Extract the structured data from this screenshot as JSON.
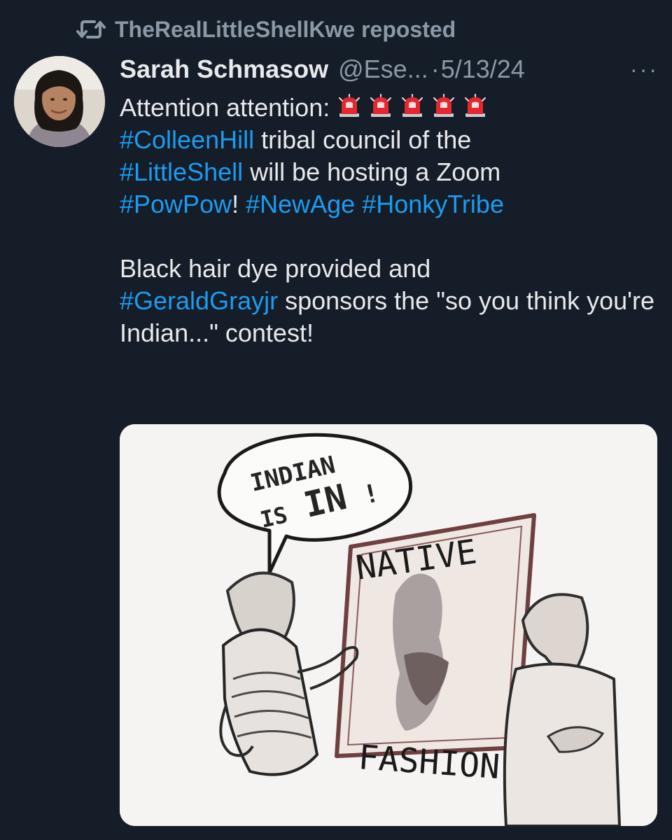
{
  "repost": {
    "icon": "repost-icon",
    "text": "TheRealLittleShellKwe reposted"
  },
  "author": {
    "avatar": "avatar",
    "name": "Sarah Schmasow",
    "handle": "@Ese...",
    "separator": "·",
    "date": "5/13/24",
    "more_icon": "more-icon",
    "more_text": "···"
  },
  "tweet": {
    "line1_text": "Attention attention:",
    "siren_icon": "siren-icon",
    "siren_count": 5,
    "tag_colleenhill": "#ColleenHill",
    "text_tribal_council": " tribal council of the",
    "tag_littleshell": "#LittleShell",
    "text_hosting": " will be hosting a Zoom",
    "tag_powpow": "#PowPow",
    "text_bang": "! ",
    "tag_newage": "#NewAge",
    "text_space": " ",
    "tag_honkytribe": "#HonkyTribe",
    "text_hair": "Black hair dye provided and",
    "tag_geraldgray": "#GeraldGrayjr",
    "text_sponsors": " sponsors the \"so you think you're Indian...\" contest!"
  },
  "media": {
    "speech_line1": "INDIAN",
    "speech_line2_prefix": "IS",
    "speech_line2_emphasis": "IN",
    "speech_line2_suffix": "!",
    "poster_top": "NATIVE",
    "poster_bottom": "FASHION"
  },
  "colors": {
    "background": "#151d28",
    "primary_text": "#e7e9ea",
    "secondary_text": "#8b98a5",
    "hashtag": "#1d9bf0",
    "siren_red": "#e5282f"
  }
}
